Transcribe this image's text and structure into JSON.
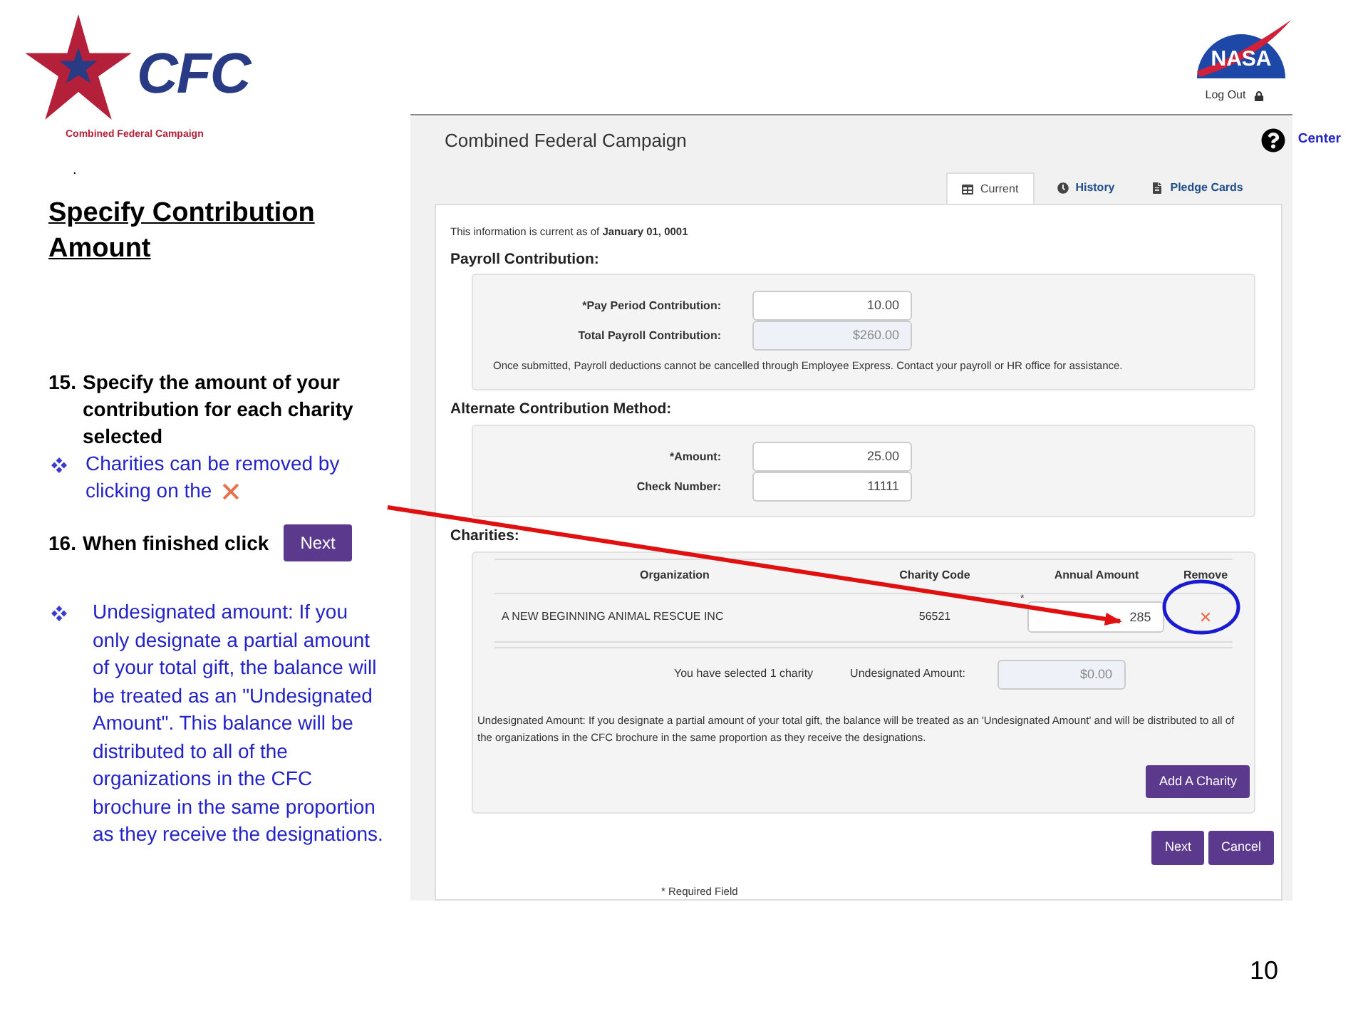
{
  "logo": {
    "mark": "CFC",
    "name": "Combined Federal Campaign"
  },
  "stray_mark": ".",
  "slide": {
    "title": "Specify Contribution Amount",
    "page_number": "10",
    "steps": [
      {
        "kind": "step",
        "number": "15.",
        "text": "Specify the amount of your contribution for each charity selected"
      },
      {
        "kind": "bullet-remove",
        "text": "Charities can be removed by clicking on the"
      },
      {
        "kind": "step-button",
        "number": "16.",
        "text": "When finished click",
        "button": "Next"
      },
      {
        "kind": "bullet",
        "text": "Undesignated amount: If you only designate a partial amount of your total gift, the balance will be treated as an \"Undesignated Amount\". This balance will be distributed to all of the organizations in the CFC brochure in the same proportion as they receive the designations."
      }
    ]
  },
  "agency_logo": {
    "text": "NASA"
  },
  "screenshot": {
    "log_out": "Log Out",
    "title": "Combined Federal Campaign",
    "help_link": "Center",
    "tabs": [
      {
        "label": "Current",
        "selected": true
      },
      {
        "label": "History",
        "selected": false
      },
      {
        "label": "Pledge Cards",
        "selected": false
      }
    ],
    "info": "This information is current as of **January 01, 0001**",
    "payroll": {
      "heading": "Payroll Contribution:",
      "fields": [
        {
          "label": "*Pay Period Contribution:",
          "value": "10.00",
          "disabled": false
        },
        {
          "label": "Total Payroll Contribution:",
          "value": "$260.00",
          "disabled": true
        }
      ],
      "note": "Once submitted, Payroll deductions cannot be cancelled through Employee Express. Contact your payroll or HR office for assistance."
    },
    "alternate": {
      "heading": "Alternate Contribution Method:",
      "fields": [
        {
          "label": "*Amount:",
          "value": "25.00",
          "disabled": false
        },
        {
          "label": "Check Number:",
          "value": "11111",
          "disabled": false
        }
      ]
    },
    "charities": {
      "heading": "Charities:",
      "columns": [
        "Organization",
        "Charity Code",
        "Annual Amount",
        "Remove"
      ],
      "rows": [
        {
          "organization": "A NEW BEGINNING ANIMAL RESCUE INC",
          "charity_code": "56521",
          "required_mark": "*",
          "annual_amount": "285"
        }
      ],
      "summary": "You have selected 1 charity",
      "undesignated_label": "Undesignated Amount:",
      "undesignated": {
        "value": "$0.00",
        "disabled": true
      },
      "note": "Undesignated Amount: If you designate a partial amount of your total gift, the balance will be treated as an 'Undesignated Amount' and will be distributed to all of the organizations in the CFC brochure in the same proportion as they receive the designations.",
      "add_button": "Add A Charity"
    },
    "buttons": [
      "Next",
      "Cancel"
    ],
    "footnote": "* Required Field"
  }
}
